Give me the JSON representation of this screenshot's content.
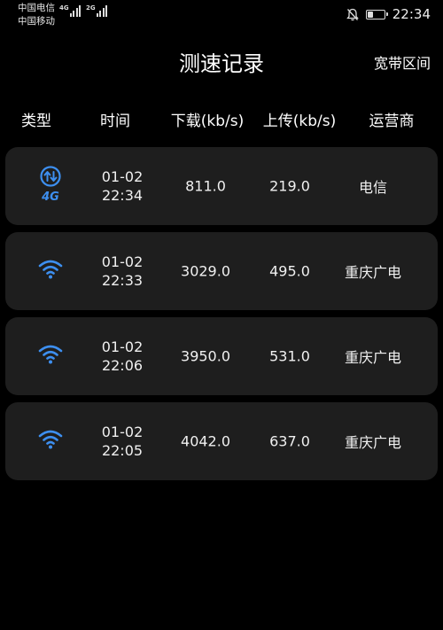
{
  "status_bar": {
    "carrier_1": "中国电信",
    "carrier_2": "中国移动",
    "net_1": "4G",
    "net_2": "2G",
    "time": "22:34",
    "battery_level": 0.3,
    "icons": [
      "signal-icon",
      "mute-notification-icon",
      "battery-icon"
    ]
  },
  "header": {
    "title": "测速记录",
    "action_label": "宽带区间"
  },
  "columns": {
    "type": "类型",
    "time": "时间",
    "download": "下载(kb/s)",
    "upload": "上传(kb/s)",
    "carrier": "运营商"
  },
  "records": [
    {
      "type_icon": "4g-icon",
      "date": "01-02",
      "time": "22:34",
      "download": "811.0",
      "upload": "219.0",
      "carrier": "电信"
    },
    {
      "type_icon": "wifi-icon",
      "date": "01-02",
      "time": "22:33",
      "download": "3029.0",
      "upload": "495.0",
      "carrier": "重庆广电"
    },
    {
      "type_icon": "wifi-icon",
      "date": "01-02",
      "time": "22:06",
      "download": "3950.0",
      "upload": "531.0",
      "carrier": "重庆广电"
    },
    {
      "type_icon": "wifi-icon",
      "date": "01-02",
      "time": "22:05",
      "download": "4042.0",
      "upload": "637.0",
      "carrier": "重庆广电"
    }
  ],
  "colors": {
    "background": "#000000",
    "row_background": "#1e1e1e",
    "icon_accent": "#3d8ff0",
    "text": "#ffffff"
  }
}
